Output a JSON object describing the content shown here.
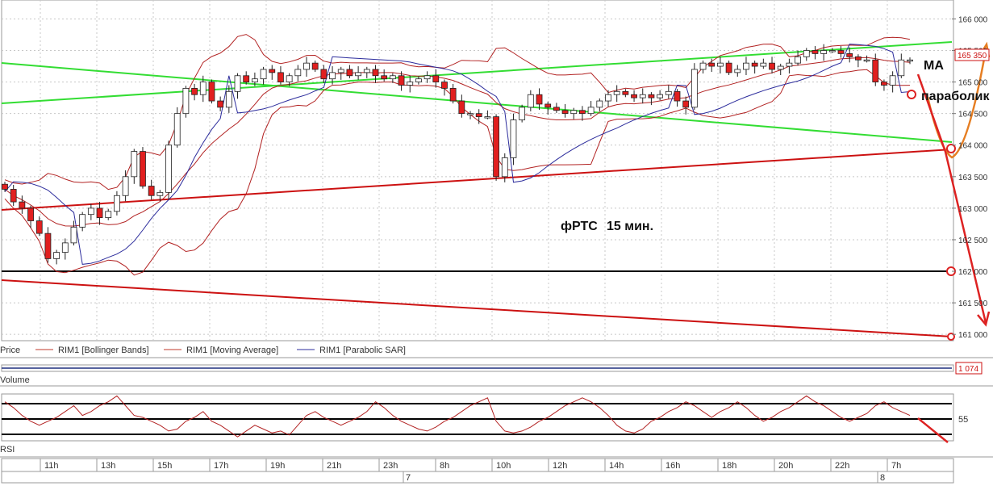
{
  "chart_data": [
    {
      "type": "candlestick",
      "instrument_note": "фРТС",
      "timeframe_note": "15 мин.",
      "y_ticks": [
        161000,
        161500,
        162000,
        162500,
        163000,
        163500,
        164000,
        164500,
        165000,
        165500,
        166000
      ],
      "y_tick_labels": [
        "161 000",
        "161 500",
        "162 000",
        "162 500",
        "163 000",
        "163 500",
        "164 000",
        "164 500",
        "165 000",
        "165 500",
        "166 000"
      ],
      "ylim": [
        160900,
        166300
      ],
      "last_price_label": "165 350",
      "x_time_labels": [
        "11h",
        "13h",
        "15h",
        "17h",
        "19h",
        "21h",
        "23h",
        "8h",
        "10h",
        "12h",
        "14h",
        "16h",
        "18h",
        "20h",
        "22h",
        "7h"
      ],
      "x_date_labels": [
        "7",
        "8"
      ],
      "legend": [
        {
          "label": "Price"
        },
        {
          "label": "RIM1 [Bollinger Bands]",
          "color": "#c0392b"
        },
        {
          "label": "RIM1 [Moving Average]",
          "color": "#c0392b"
        },
        {
          "label": "RIM1 [Parabolic SAR]",
          "color": "#2c2c9c"
        }
      ],
      "closes": [
        163300,
        163100,
        163000,
        162800,
        162600,
        162200,
        162300,
        162450,
        162700,
        162900,
        163000,
        162850,
        162950,
        163200,
        163500,
        163900,
        163350,
        163200,
        163250,
        164000,
        164500,
        164900,
        164800,
        165000,
        164700,
        164600,
        164850,
        165100,
        165000,
        165050,
        165200,
        165150,
        165000,
        165100,
        165200,
        165300,
        165200,
        165050,
        165150,
        165200,
        165100,
        165150,
        165200,
        165100,
        165050,
        165100,
        164950,
        165000,
        165050,
        165100,
        165000,
        164900,
        164700,
        164500,
        164500,
        164450,
        164450,
        163500,
        163800,
        164400,
        164600,
        164800,
        164650,
        164600,
        164550,
        164500,
        164550,
        164500,
        164600,
        164700,
        164800,
        164850,
        164800,
        164750,
        164800,
        164750,
        164800,
        164850,
        164700,
        164600,
        165200,
        165300,
        165250,
        165300,
        165150,
        165200,
        165300,
        165250,
        165300,
        165200,
        165250,
        165300,
        165400,
        165500,
        165450,
        165500,
        165500,
        165450,
        165400,
        165350,
        165350,
        165000,
        164950,
        165100,
        165350,
        165350
      ],
      "annotations": [
        {
          "text": "МА"
        },
        {
          "text": "параболик"
        }
      ]
    },
    {
      "type": "bar",
      "name": "Volume",
      "last_value_label": "1 074"
    },
    {
      "type": "line",
      "name": "RSI",
      "y_tick_labels": [
        "55"
      ],
      "values": [
        60,
        57,
        53,
        50,
        48,
        50,
        52,
        55,
        58,
        53,
        55,
        58,
        60,
        63,
        58,
        53,
        52,
        50,
        48,
        45,
        46,
        50,
        52,
        55,
        50,
        48,
        45,
        42,
        45,
        48,
        46,
        44,
        45,
        43,
        48,
        53,
        55,
        52,
        50,
        48,
        50,
        52,
        55,
        60,
        57,
        53,
        50,
        48,
        46,
        45,
        47,
        50,
        52,
        55,
        58,
        60,
        62,
        50,
        45,
        44,
        45,
        47,
        50,
        52,
        55,
        58,
        60,
        62,
        60,
        57,
        53,
        48,
        45,
        44,
        46,
        50,
        52,
        55,
        57,
        60,
        58,
        55,
        52,
        55,
        57,
        60,
        57,
        53,
        50,
        52,
        55,
        57,
        60,
        63,
        60,
        58,
        55,
        52,
        50,
        52,
        54,
        58,
        60,
        57,
        55,
        53
      ]
    }
  ]
}
